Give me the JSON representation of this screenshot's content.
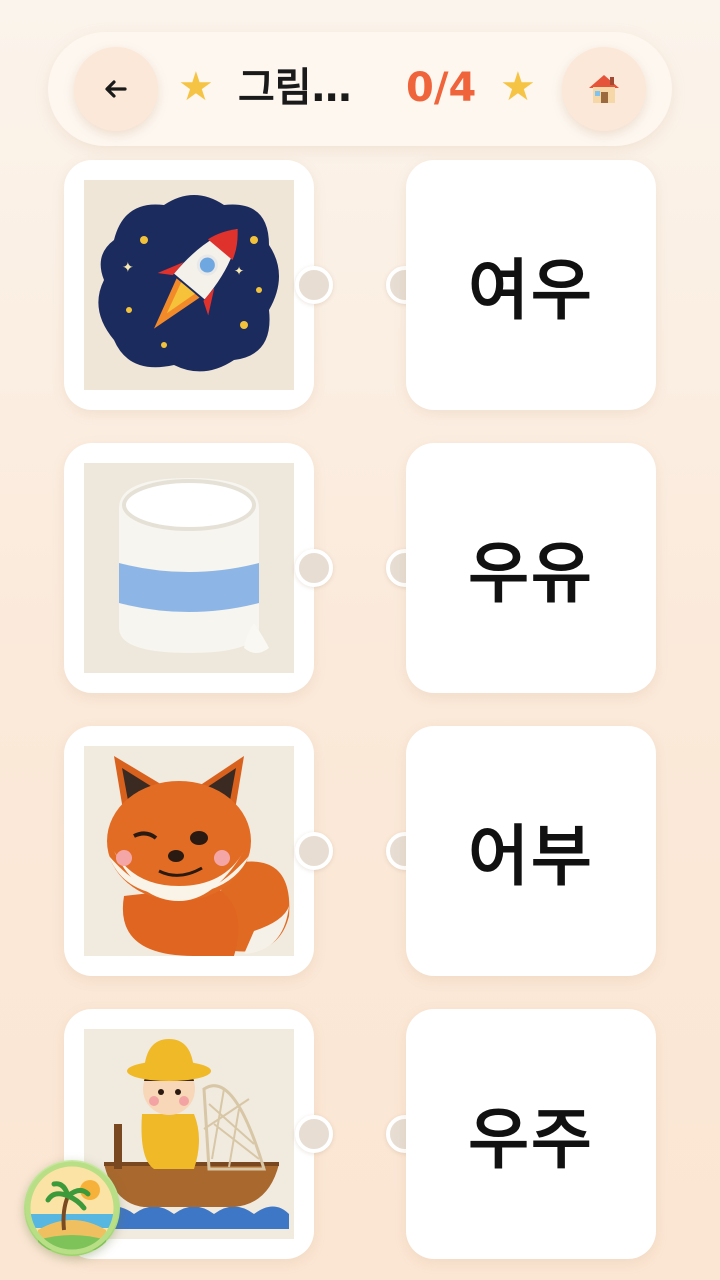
{
  "header": {
    "back_icon": "arrow-left-icon",
    "title": "그림…",
    "progress": "0/4",
    "star_icon": "star-icon",
    "home_icon": "house-icon",
    "star_color": "#f6c445",
    "progress_color": "#f0643c"
  },
  "pictures": [
    {
      "subject": "rocket-icon"
    },
    {
      "subject": "milk-cup-icon"
    },
    {
      "subject": "fox-icon"
    },
    {
      "subject": "fisherman-boat-icon"
    }
  ],
  "words": [
    "여우",
    "우유",
    "어부",
    "우주"
  ],
  "logo": {
    "icon": "island-sunset-logo-icon"
  }
}
